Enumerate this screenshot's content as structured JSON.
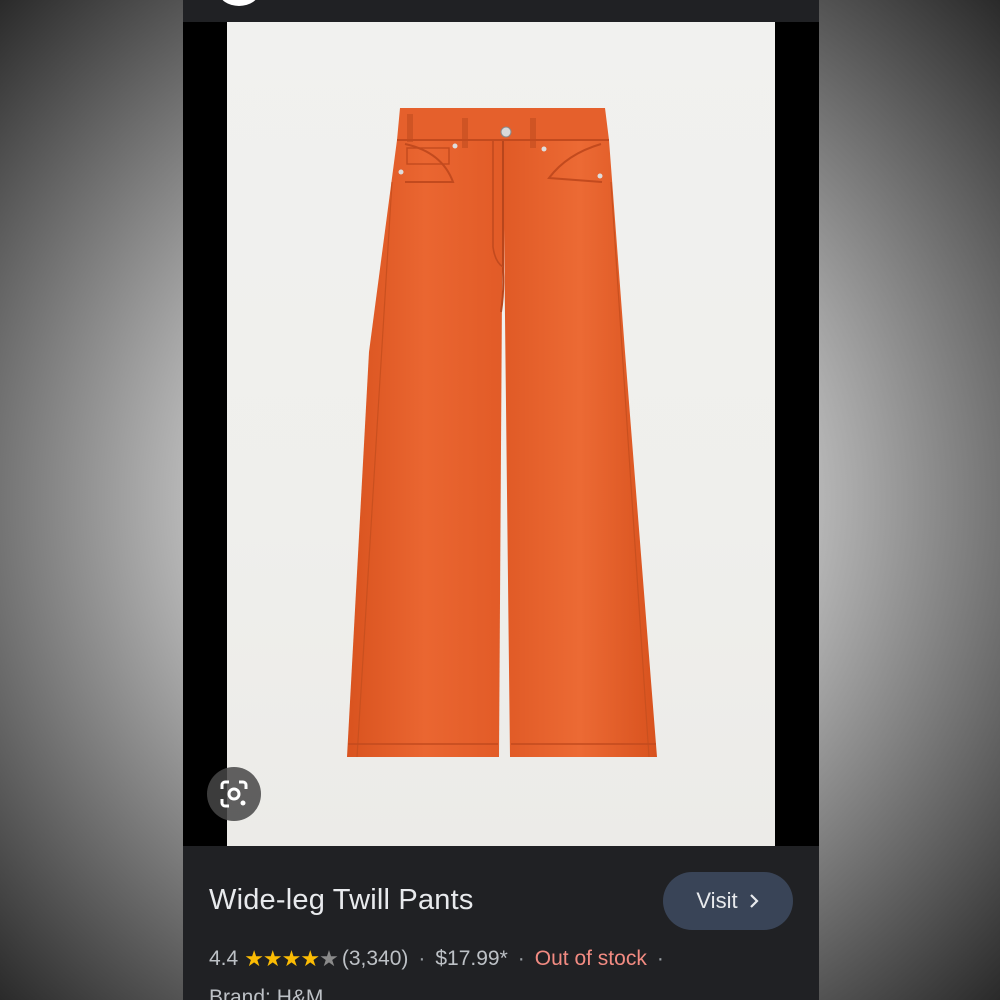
{
  "product": {
    "title": "Wide-leg Twill Pants",
    "visit_label": "Visit",
    "rating": "4.4",
    "stars": "★★★★",
    "half_star": "★",
    "review_count": "(3,340)",
    "price": "$17.99*",
    "stock_status": "Out of stock",
    "separator": "·",
    "brand": "Brand: H&M"
  },
  "icons": {
    "lens": "google-lens-icon",
    "visit": "chevron-right-icon"
  },
  "colors": {
    "pants": "#e8622f",
    "stars": "#fbbc04",
    "out_of_stock": "#f28b82",
    "visit_button": "#394457"
  }
}
